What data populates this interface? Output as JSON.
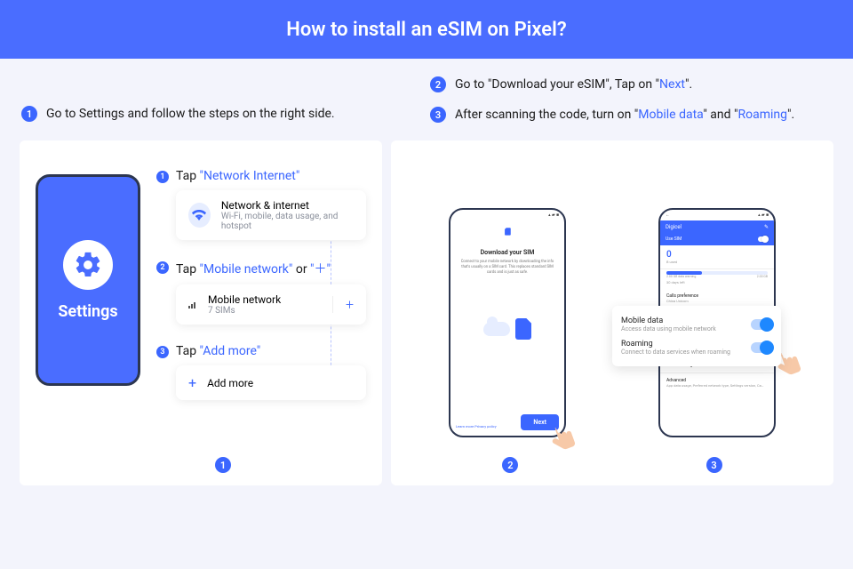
{
  "header": {
    "title": "How to install an eSIM on Pixel?"
  },
  "top": {
    "left": {
      "num": "1",
      "text": "Go to Settings and follow the steps on the right side."
    },
    "right": [
      {
        "num": "2",
        "pre": "Go to \"Download your eSIM\", Tap on \"",
        "link": "Next",
        "post": "\"."
      },
      {
        "num": "3",
        "pre": "After scanning the code, turn on \"",
        "link1": "Mobile data",
        "mid": "\" and \"",
        "link2": "Roaming",
        "post": "\"."
      }
    ]
  },
  "left_panel": {
    "phone_label": "Settings",
    "steps": [
      {
        "num": "1",
        "pre": "Tap ",
        "link": "\"Network Internet\"",
        "card": {
          "title": "Network & internet",
          "sub": "Wi-Fi, mobile, data usage, and hotspot"
        }
      },
      {
        "num": "2",
        "pre": "Tap ",
        "link": "\"Mobile network\"",
        "mid": " or ",
        "link2": "\"＋\"",
        "card": {
          "title": "Mobile network",
          "sub": "7 SIMs",
          "plus": "+"
        }
      },
      {
        "num": "3",
        "pre": "Tap ",
        "link": "\"Add more\"",
        "card": {
          "title": "Add more"
        }
      }
    ],
    "bottom_badge": "1"
  },
  "right_panel": {
    "phone2": {
      "title": "Download your SIM",
      "desc": "Connect to your mobile network by downloading the info that's usually on a SIM card. This replaces standard SIM cards and is just as safe.",
      "footer_links": "Learn more  Privacy policy",
      "next": "Next"
    },
    "phone3": {
      "carrier": "Digicel",
      "use_sim": "Use SIM",
      "zero": "0",
      "zero_sub": "B used",
      "bar_left": "2.00 GB data warning",
      "bar_right": "2.00 GB",
      "days": "30 days left",
      "calls_t": "Calls preference",
      "calls_s": "China Unicom",
      "warn": "Data warning & limit",
      "adv_t": "Advanced",
      "adv_s": "App data usage, Preferred network type, Settings version, Ca…"
    },
    "overlay": {
      "mobile_t": "Mobile data",
      "mobile_s": "Access data using mobile network",
      "roam_t": "Roaming",
      "roam_s": "Connect to data services when roaming"
    },
    "badge2": "2",
    "badge3": "3"
  }
}
